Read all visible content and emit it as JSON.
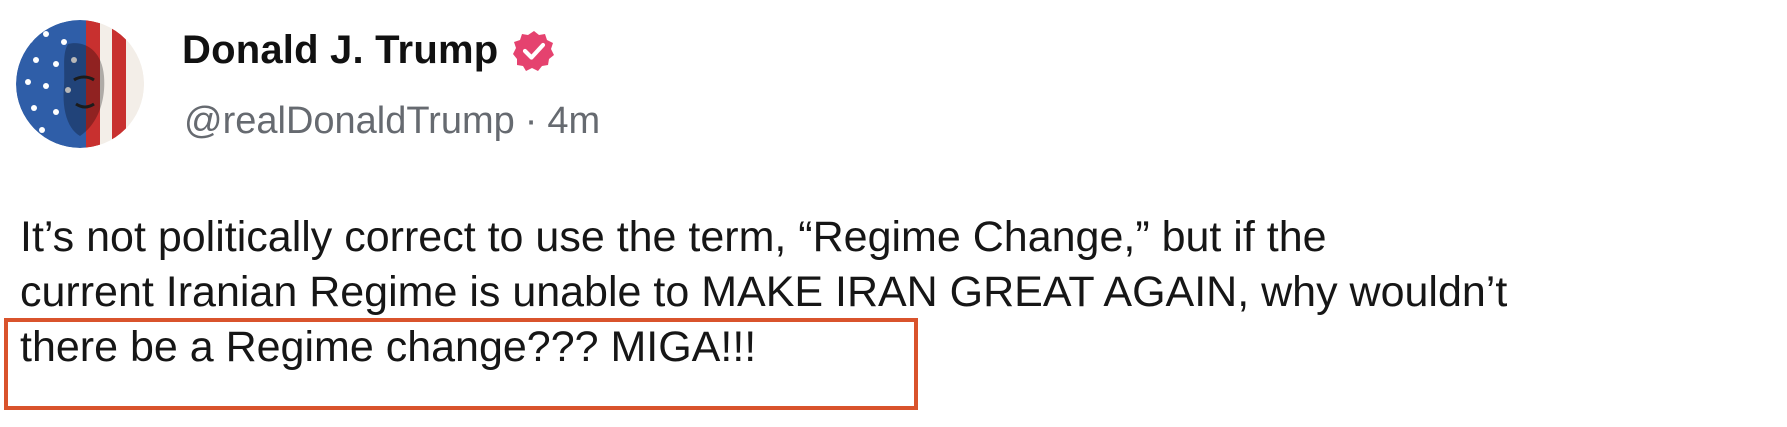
{
  "author": {
    "name": "Donald J. Trump",
    "handle": "@realDonaldTrump",
    "separator": "·",
    "time": "4m",
    "verified_badge_icon": "verified-badge-icon",
    "verified_color": "#e5426f"
  },
  "post": {
    "lines": [
      "It’s not politically correct to use the term, “Regime Change,” but if the",
      "current Iranian Regime is unable to MAKE IRAN GREAT AGAIN, why wouldn’t",
      "there be a Regime change??? MIGA!!!"
    ]
  },
  "annotation": {
    "highlight_color": "#d9532c"
  }
}
